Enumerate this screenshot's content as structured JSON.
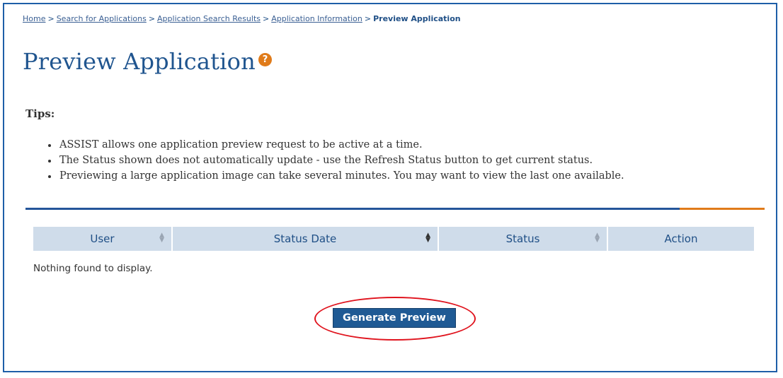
{
  "breadcrumb": {
    "links": [
      "Home",
      "Search for Applications",
      "Application Search Results",
      "Application Information"
    ],
    "separator": ">",
    "current": "Preview Application"
  },
  "page": {
    "title": "Preview Application",
    "help_icon": "question-circle-icon",
    "help_glyph": "?"
  },
  "tips": {
    "label": "Tips:",
    "items": [
      "ASSIST allows one application preview request to be active at a time.",
      "The Status shown does not automatically update - use the Refresh Status button to get current status.",
      "Previewing a large application image can take several minutes.  You may want to view the last one available."
    ]
  },
  "table": {
    "columns": [
      {
        "label": "User",
        "sortable": true,
        "sorted": false
      },
      {
        "label": "Status Date",
        "sortable": true,
        "sorted": true
      },
      {
        "label": "Status",
        "sortable": true,
        "sorted": false
      },
      {
        "label": "Action",
        "sortable": false,
        "sorted": false
      }
    ],
    "empty_message": "Nothing found to display."
  },
  "actions": {
    "generate_label": "Generate Preview"
  },
  "colors": {
    "frame_border": "#1e5fa8",
    "title": "#20558f",
    "help_icon": "#e07b1a",
    "divider_blue": "#24559a",
    "divider_orange": "#e07b1a",
    "header_bg": "#cfdcea",
    "button_bg": "#1f5a94",
    "highlight": "#e0141e"
  }
}
